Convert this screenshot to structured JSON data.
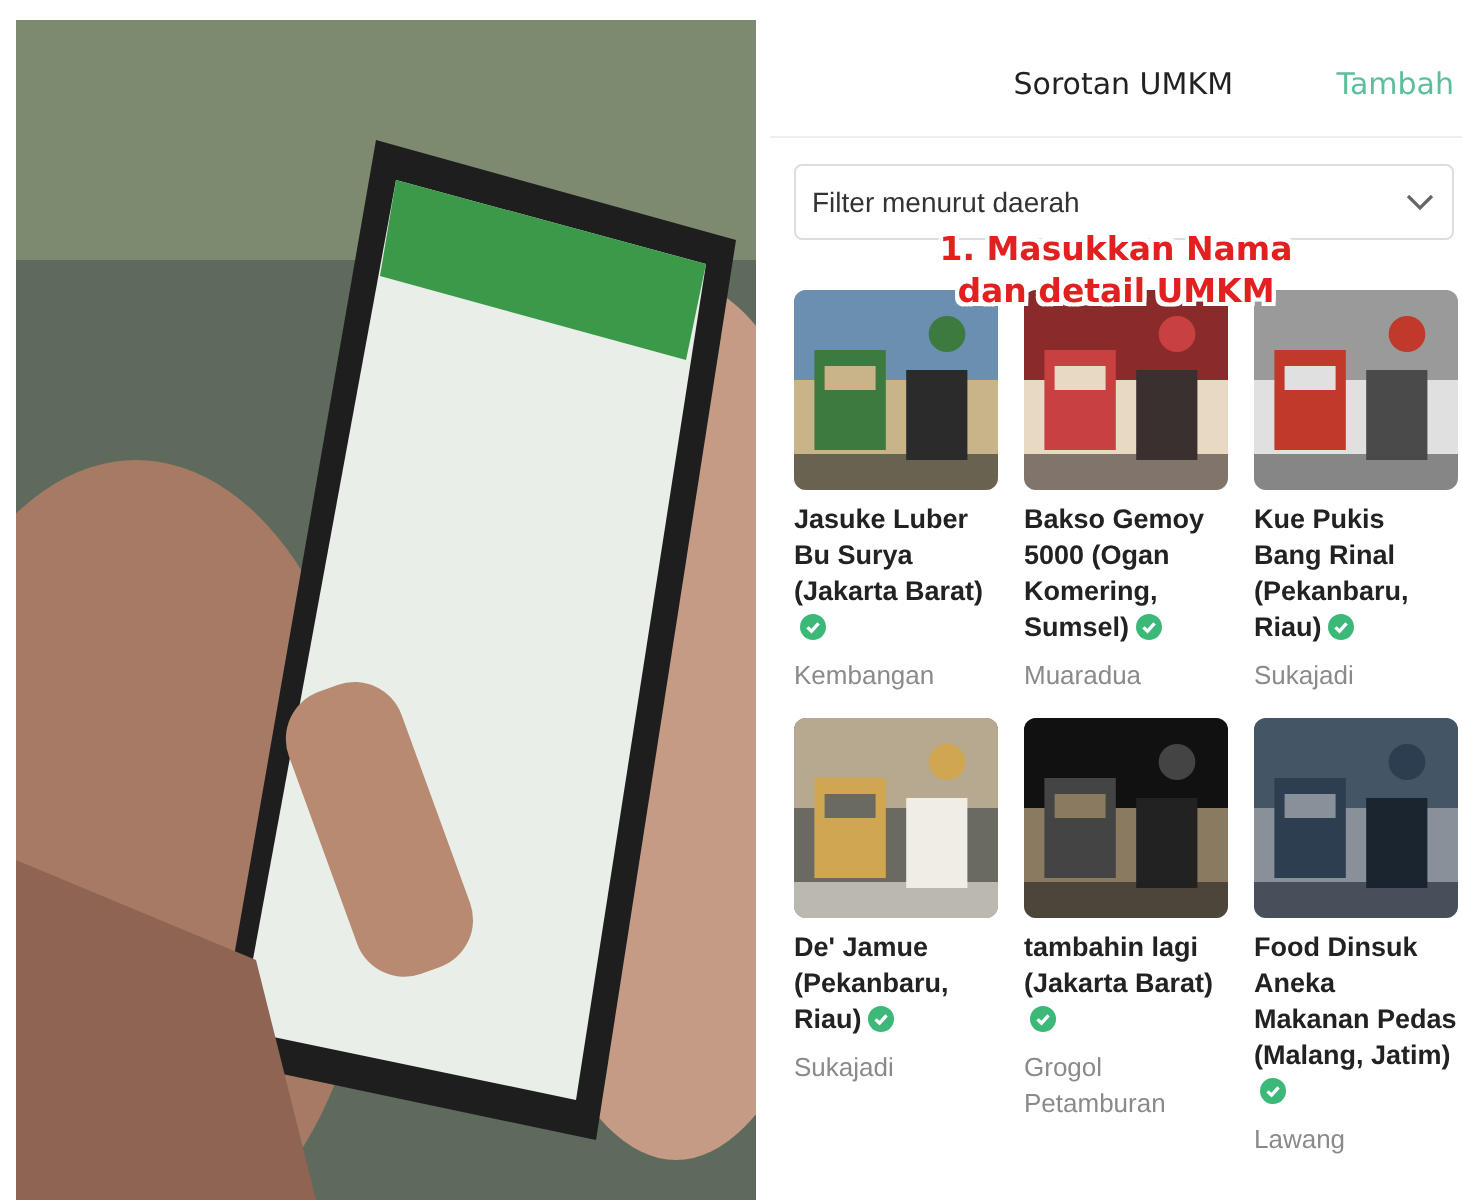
{
  "app": {
    "title": "Sorotan UMKM",
    "action": "Tambah",
    "filter": {
      "placeholder": "Filter menurut daerah"
    },
    "caption": [
      "1. Masukkan Nama",
      "dan detail UMKM"
    ],
    "items": [
      {
        "name": "Jasuke Luber Bu Surya (Jakarta Barat)",
        "verified": true,
        "location": "Kembangan"
      },
      {
        "name": "Bakso Gemoy 5000 (Ogan Komering, Sumsel)",
        "verified": true,
        "location": "Muaradua"
      },
      {
        "name": "Kue Pukis Bang Rinal (Pekanbaru, Riau)",
        "verified": true,
        "location": "Sukajadi"
      },
      {
        "name": "De' Jamue (Pekanbaru, Riau)",
        "verified": true,
        "location": "Sukajadi"
      },
      {
        "name": "tambahin lagi (Jakarta Barat)",
        "verified": true,
        "location": "Grogol Petamburan"
      },
      {
        "name": "Food Dinsuk Aneka Makanan Pedas (Malang, Jatim)",
        "verified": true,
        "location": "Lawang"
      }
    ]
  }
}
